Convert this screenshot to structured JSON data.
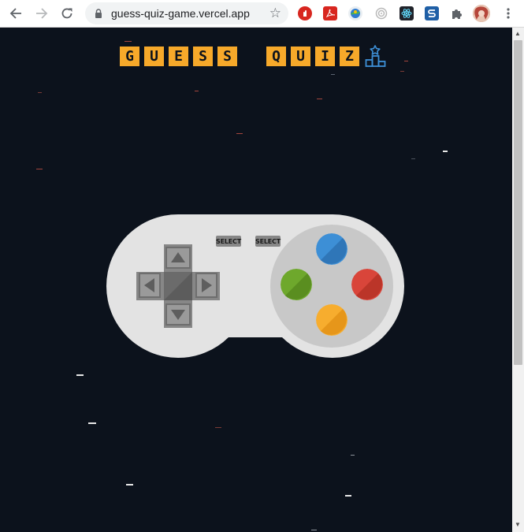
{
  "browser": {
    "url": "guess-quiz-game.vercel.app",
    "nav": {
      "back_icon": "arrow-left-icon",
      "forward_icon": "arrow-right-icon",
      "reload_icon": "reload-icon"
    },
    "extensions": [
      "adblock-icon",
      "pdf-icon",
      "extension-globe-icon",
      "extension-target-icon",
      "react-devtools-icon",
      "extension-s-icon",
      "puzzle-icon"
    ],
    "menu_icon": "kebab-menu-icon"
  },
  "game": {
    "title_word1": [
      "G",
      "U",
      "E",
      "S",
      "S"
    ],
    "title_word2": [
      "Q",
      "U",
      "I",
      "Z"
    ],
    "title_color": "#f7a92a",
    "podium_icon": "podium-icon",
    "controller": {
      "select_left": "SELECT",
      "select_right": "SELECT",
      "buttons": {
        "top": "#3d8fd6",
        "left": "#6ea82c",
        "right": "#d9453a",
        "bottom": "#f7ad2e"
      }
    }
  },
  "colors": {
    "background": "#0c121c",
    "controller_body": "#e3e3e3",
    "controller_pad": "#c8c8c8"
  }
}
